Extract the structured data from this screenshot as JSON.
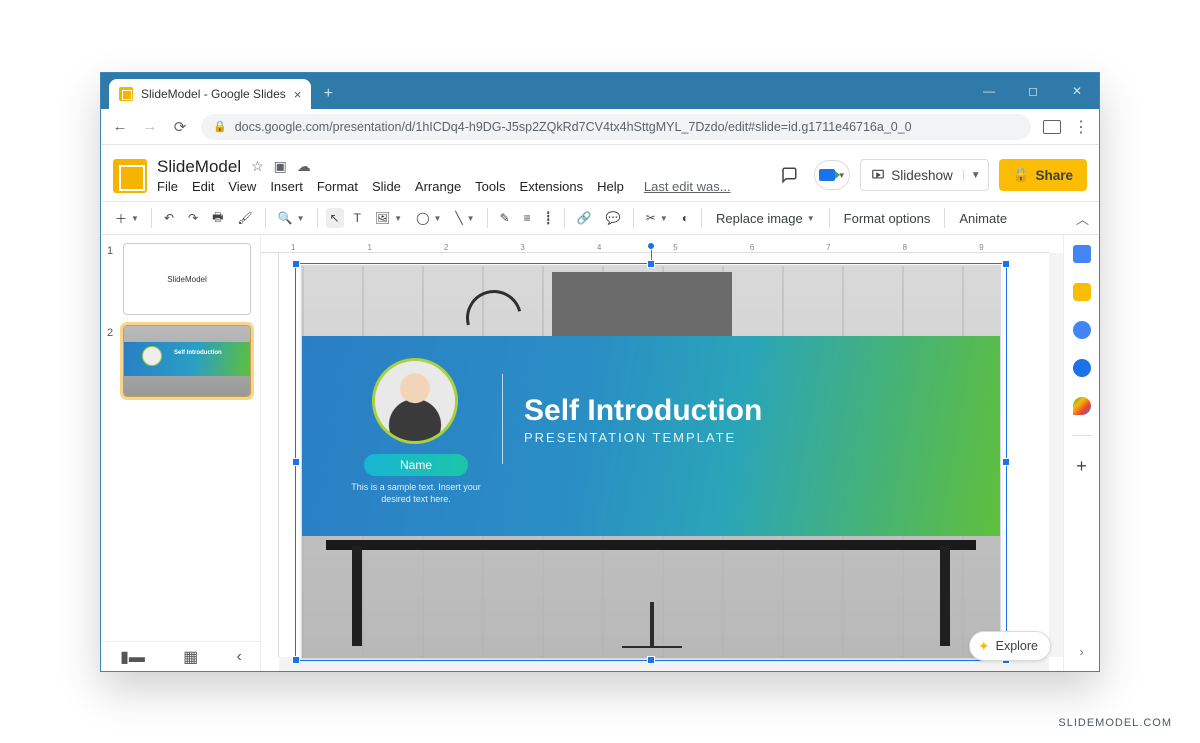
{
  "browser": {
    "tab_title": "SlideModel - Google Slides",
    "url": "docs.google.com/presentation/d/1hICDq4-h9DG-J5sp2ZQkRd7CV4tx4hSttgMYL_7Dzdo/edit#slide=id.g1711e46716a_0_0"
  },
  "app": {
    "doc_name": "SlideModel",
    "last_edit": "Last edit was...",
    "menus": [
      "File",
      "Edit",
      "View",
      "Insert",
      "Format",
      "Slide",
      "Arrange",
      "Tools",
      "Extensions",
      "Help"
    ],
    "slideshow_label": "Slideshow",
    "share_label": "Share"
  },
  "toolbar": {
    "replace_image": "Replace image",
    "format_options": "Format options",
    "animate": "Animate"
  },
  "ruler_ticks": [
    "1",
    "1",
    "2",
    "3",
    "4",
    "5",
    "6",
    "7",
    "8",
    "9"
  ],
  "thumbs": {
    "n1": "1",
    "n2": "2",
    "slide1_text": "SlideModel",
    "slide2_mini_title": "Self Introduction"
  },
  "slide": {
    "title": "Self Introduction",
    "subtitle": "PRESENTATION TEMPLATE",
    "name_chip": "Name",
    "sample": "This is a sample text. Insert your desired text here."
  },
  "explore": "Explore",
  "watermark": "SLIDEMODEL.COM"
}
